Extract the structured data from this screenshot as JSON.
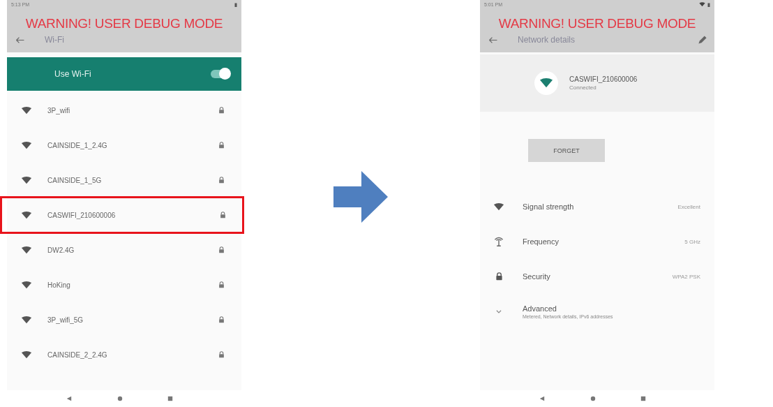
{
  "left_screen": {
    "status_time": "5:13 PM",
    "warning": "WARNING! USER DEBUG MODE",
    "title": "Wi-Fi",
    "master_switch": {
      "label": "Use Wi-Fi",
      "on": true
    },
    "networks": [
      {
        "name": "3P_wifi",
        "selected": false
      },
      {
        "name": "CAINSIDE_1_2.4G",
        "selected": false
      },
      {
        "name": "CAINSIDE_1_5G",
        "selected": false
      },
      {
        "name": "CASWIFI_210600006",
        "selected": true
      },
      {
        "name": "DW2.4G",
        "selected": false
      },
      {
        "name": "HoKing",
        "selected": false
      },
      {
        "name": "3P_wifi_5G",
        "selected": false
      },
      {
        "name": "CAINSIDE_2_2.4G",
        "selected": false
      }
    ]
  },
  "right_screen": {
    "status_time": "5:01 PM",
    "warning": "WARNING! USER DEBUG MODE",
    "title": "Network details",
    "network": {
      "name": "CASWIFI_210600006",
      "status": "Connected"
    },
    "forget_button": "FORGET",
    "details": [
      {
        "kind": "signal",
        "label": "Signal strength",
        "value": "Excellent"
      },
      {
        "kind": "frequency",
        "label": "Frequency",
        "value": "5 GHz"
      },
      {
        "kind": "security",
        "label": "Security",
        "value": "WPA2 PSK"
      },
      {
        "kind": "advanced",
        "label": "Advanced",
        "summary": "Metered, Network details, IPv6 addresses"
      }
    ]
  }
}
